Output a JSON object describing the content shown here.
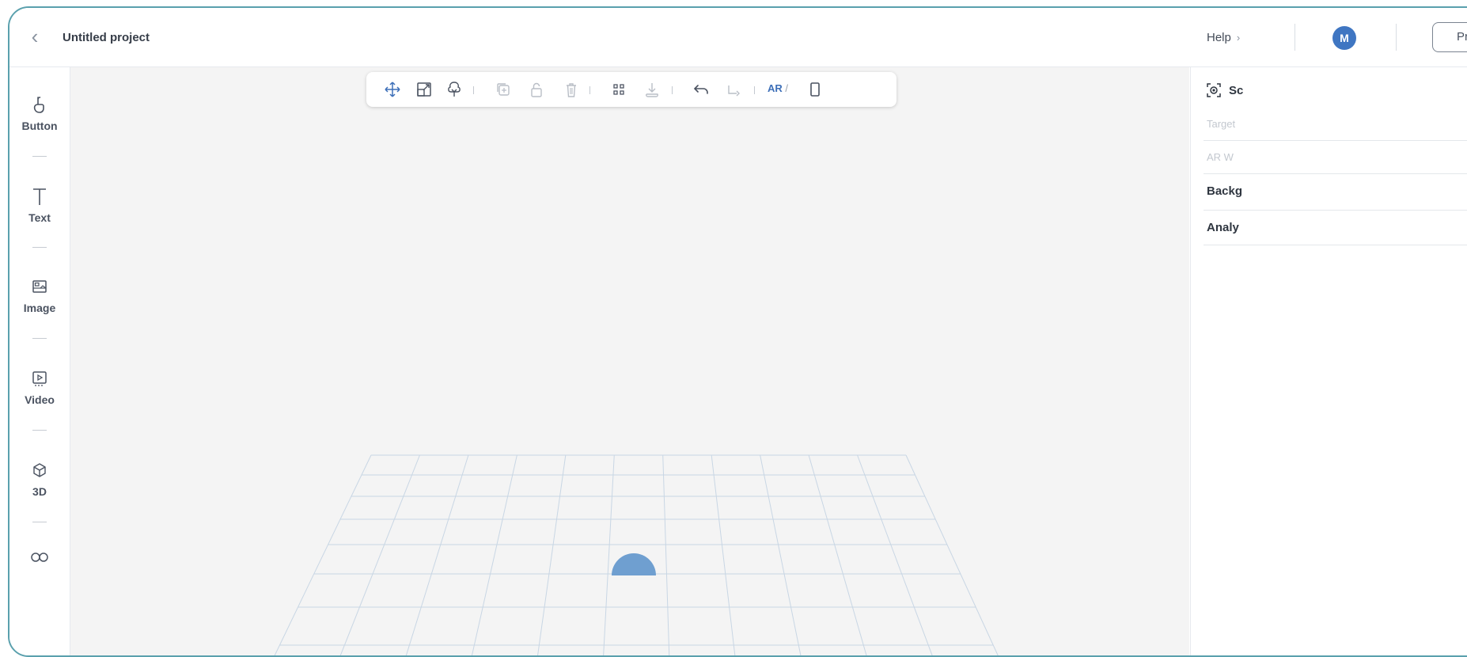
{
  "header": {
    "back_icon": "chevron-left-icon",
    "project_title": "Untitled project",
    "help_label": "Help",
    "help_arrow": "›",
    "avatar_initial": "M",
    "preview_label": "Pr"
  },
  "sidebar": {
    "items": [
      {
        "label": "Button",
        "icon": "hand-pointer-icon"
      },
      {
        "label": "Text",
        "icon": "text-icon"
      },
      {
        "label": "Image",
        "icon": "image-icon"
      },
      {
        "label": "Video",
        "icon": "video-icon"
      },
      {
        "label": "3D",
        "icon": "cube-icon"
      },
      {
        "label": "",
        "icon": "glasses-icon"
      }
    ]
  },
  "toolbar": {
    "tools": [
      "move-icon",
      "scale-icon",
      "tree-icon",
      "duplicate-icon",
      "lock-icon",
      "delete-icon",
      "qr-icon",
      "anchor-icon",
      "undo-icon",
      "redo-icon",
      "mobile-icon"
    ],
    "ar_label": "AR",
    "ar_separator": "/"
  },
  "right_panel": {
    "scene_label": "Sc",
    "target_label": "Target",
    "ar_label": "AR W",
    "background_label": "Backg",
    "analytics_label": "Analy"
  },
  "colors": {
    "accent": "#3f76c2",
    "frame_border": "#5aa0ad",
    "canvas_bg": "#f4f4f4",
    "grid_line": "#c8d6e4"
  }
}
